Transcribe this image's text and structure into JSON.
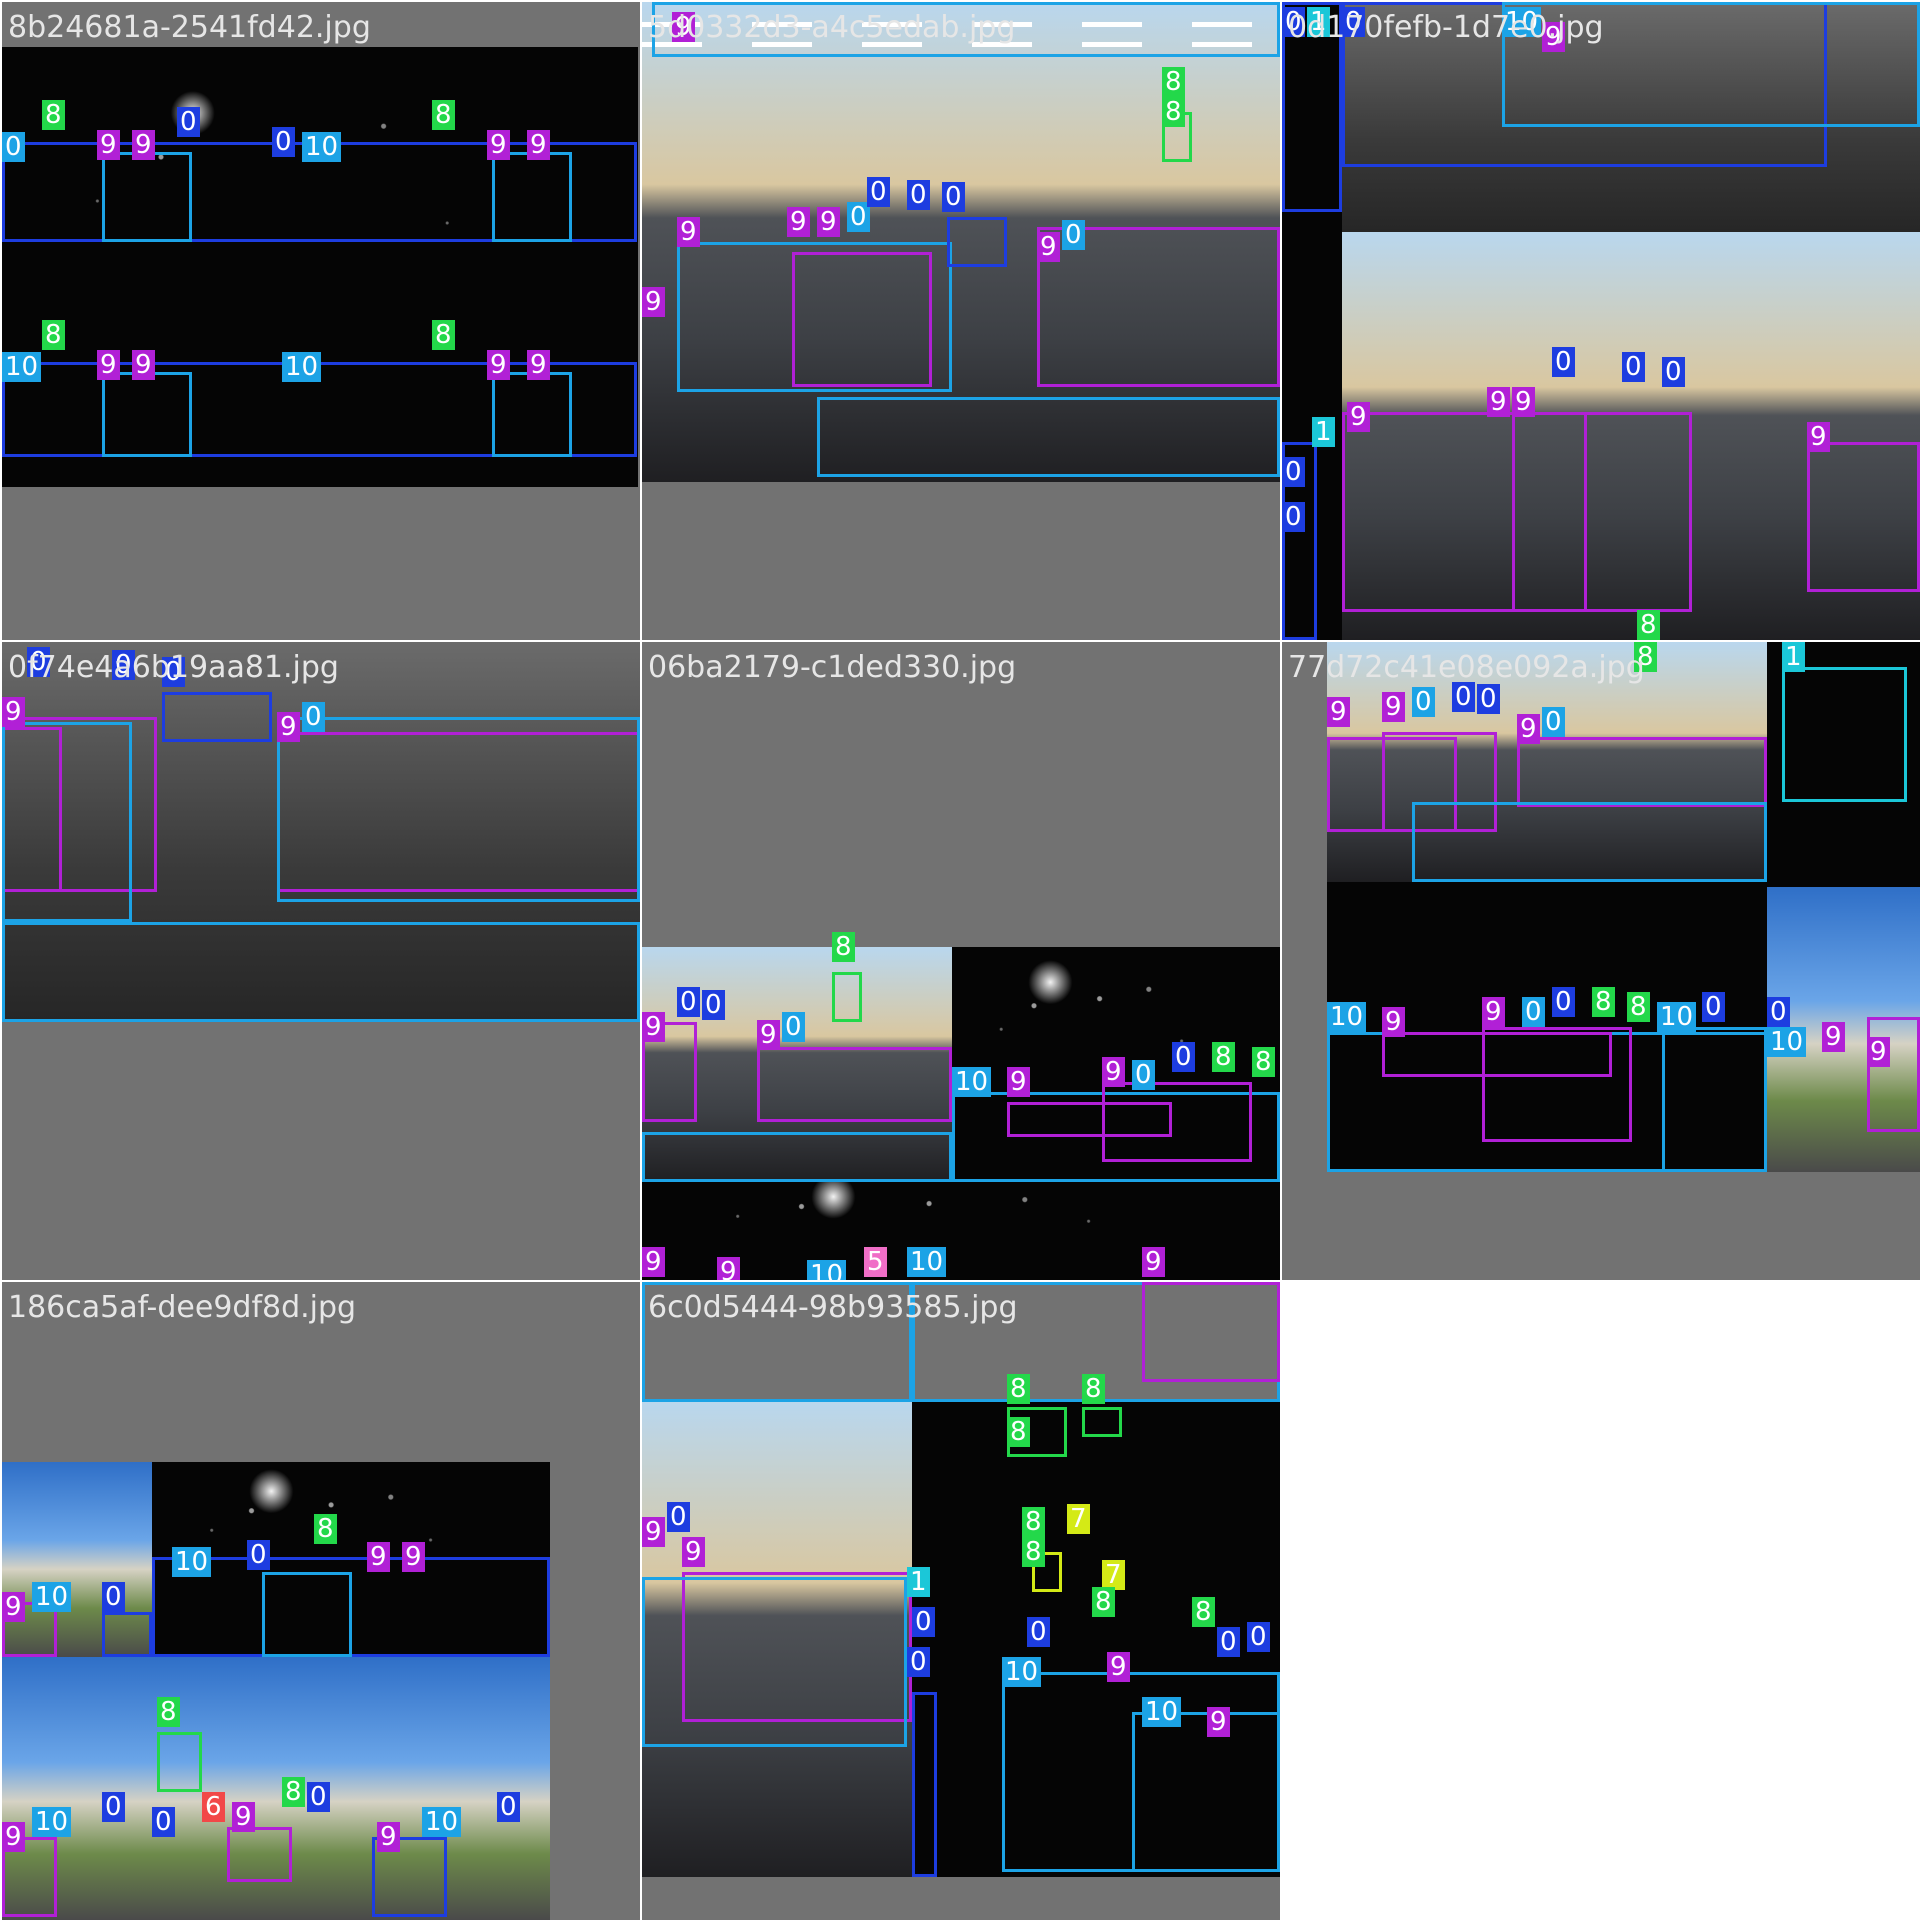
{
  "colors": {
    "class_0": "#1d3de0",
    "class_1": "#1bc7d8",
    "class_5": "#f06ec7",
    "class_6": "#f24848",
    "class_7": "#d4ea16",
    "class_8": "#23d84a",
    "class_9": "#b120d6",
    "class_10": "#1ca3e6",
    "tile_background": "#727272",
    "page_background": "#ffffff"
  },
  "tiles": [
    {
      "filename": "8b24681a-2541fd42.jpg"
    },
    {
      "filename": "5d0332d3-a4c5edab.jpg"
    },
    {
      "filename": "0d170fefb-1d7e0.jpg"
    },
    {
      "filename": "0f74e4a6b19aa81.jpg"
    },
    {
      "filename": "06ba2179-c1ded330.jpg"
    },
    {
      "filename": "77d72c41e08e092a.jpg"
    },
    {
      "filename": "186ca5af-dee9df8d.jpg"
    },
    {
      "filename": "6c0d5444-98b93585.jpg"
    }
  ],
  "detection_labels": [
    "0",
    "1",
    "5",
    "6",
    "7",
    "8",
    "9",
    "10"
  ]
}
